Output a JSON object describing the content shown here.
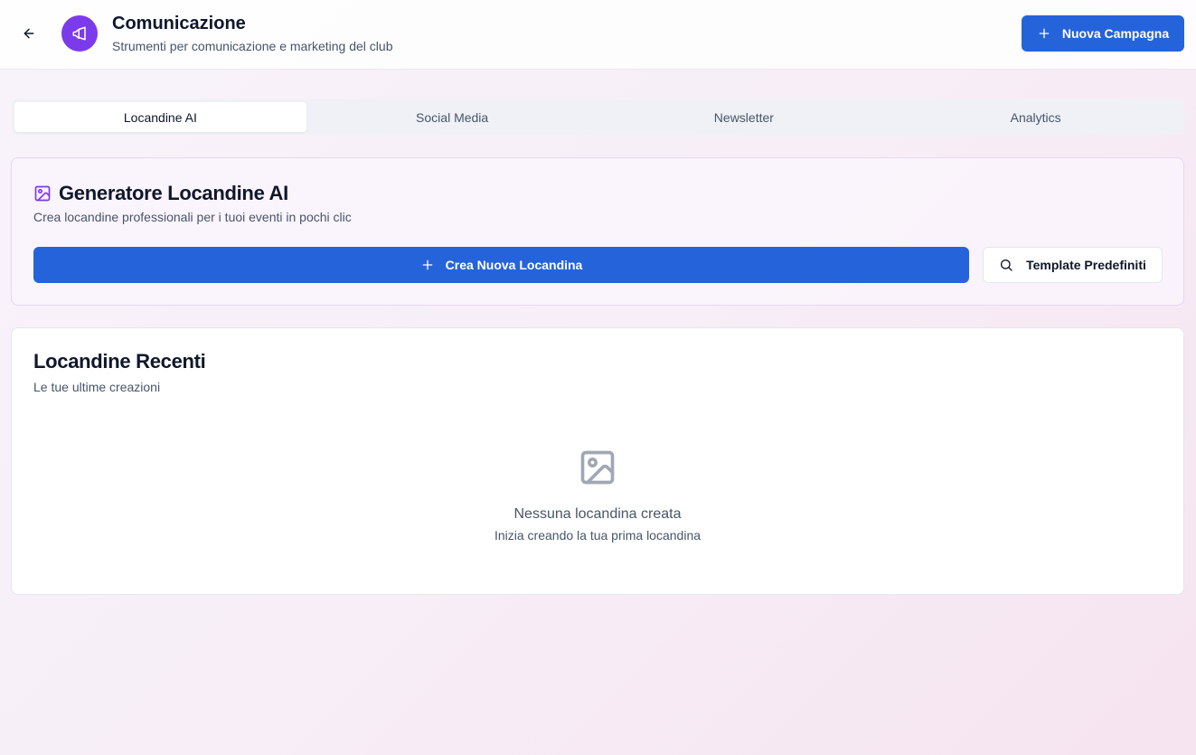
{
  "header": {
    "title": "Comunicazione",
    "subtitle": "Strumenti per comunicazione e marketing del club",
    "back_icon": "arrow-left-icon",
    "app_icon": "megaphone-icon",
    "new_campaign_label": "Nuova Campagna"
  },
  "tabs": [
    {
      "label": "Locandine AI",
      "active": true
    },
    {
      "label": "Social Media",
      "active": false
    },
    {
      "label": "Newsletter",
      "active": false
    },
    {
      "label": "Analytics",
      "active": false
    }
  ],
  "generator": {
    "icon": "image-icon",
    "title": "Generatore Locandine AI",
    "description": "Crea locandine professionali per i tuoi eventi in pochi clic",
    "create_label": "Crea Nuova Locandina",
    "template_label": "Template Predefiniti"
  },
  "recent": {
    "title": "Locandine Recenti",
    "description": "Le tue ultime creazioni",
    "empty_title": "Nessuna locandina creata",
    "empty_description": "Inizia creando la tua prima locandina"
  },
  "colors": {
    "primary": "#2563db",
    "accent": "#7c3aed"
  }
}
